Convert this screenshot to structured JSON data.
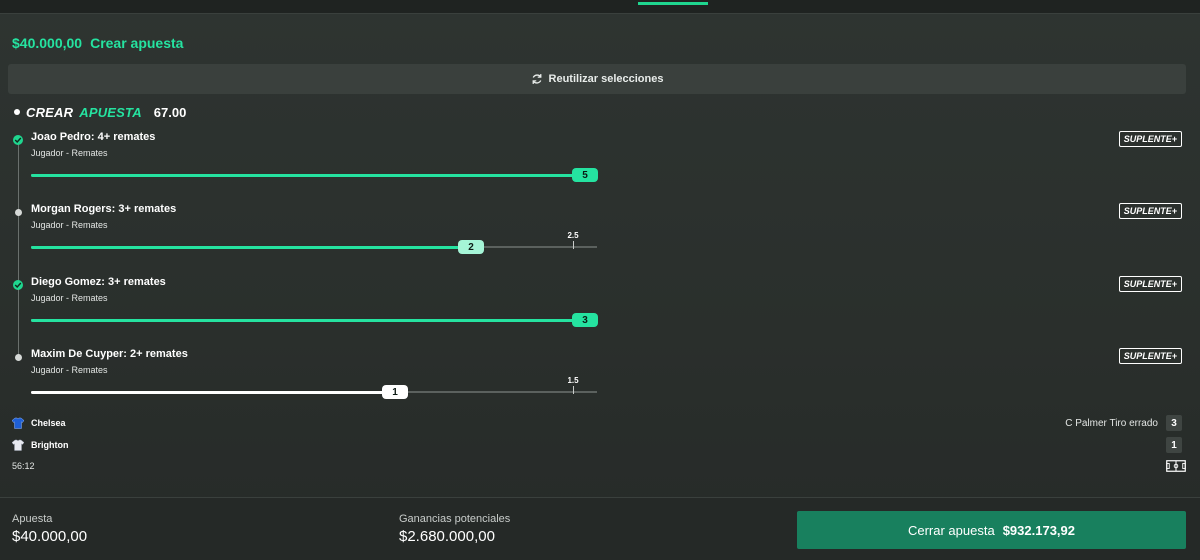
{
  "header": {
    "amount": "$40.000,00",
    "label": "Crear apuesta"
  },
  "reuse_button": {
    "label": "Reutilizar selecciones",
    "icon": "refresh-icon"
  },
  "bet_builder": {
    "title_word1": "CREAR",
    "title_word2": "APUESTA",
    "odds": "67.00"
  },
  "selections": [
    {
      "name": "Joao Pedro: 4+ remates",
      "sub": "Jugador - Remates",
      "badge": "SUPLENTE+",
      "status": "won",
      "current": "5",
      "target_label": "",
      "progress": 1.0
    },
    {
      "name": "Morgan Rogers: 3+ remates",
      "sub": "Jugador - Remates",
      "badge": "SUPLENTE+",
      "status": "pending",
      "current": "2",
      "target_label": "2.5",
      "progress": 0.8
    },
    {
      "name": "Diego Gomez: 3+ remates",
      "sub": "Jugador - Remates",
      "badge": "SUPLENTE+",
      "status": "won",
      "current": "3",
      "target_label": "",
      "progress": 1.0
    },
    {
      "name": "Maxim De Cuyper: 2+ remates",
      "sub": "Jugador - Remates",
      "badge": "SUPLENTE+",
      "status": "pending",
      "current": "1",
      "target_label": "1.5",
      "progress": 0.66
    }
  ],
  "match": {
    "home": {
      "name": "Chelsea",
      "score": "3",
      "shirt_color": "#1e5fd6"
    },
    "away": {
      "name": "Brighton",
      "score": "1",
      "shirt_color": "#e8eaf0"
    },
    "last_event": "C Palmer Tiro errado",
    "clock": "56:12"
  },
  "footer": {
    "stake_label": "Apuesta",
    "stake_value": "$40.000,00",
    "potential_label": "Ganancias potenciales",
    "potential_value": "$2.680.000,00",
    "cashout_label": "Cerrar apuesta",
    "cashout_value": "$932.173,92"
  },
  "colors": {
    "accent": "#25e3a0",
    "cashout_bg": "#18805e",
    "background": "#2b302d"
  }
}
